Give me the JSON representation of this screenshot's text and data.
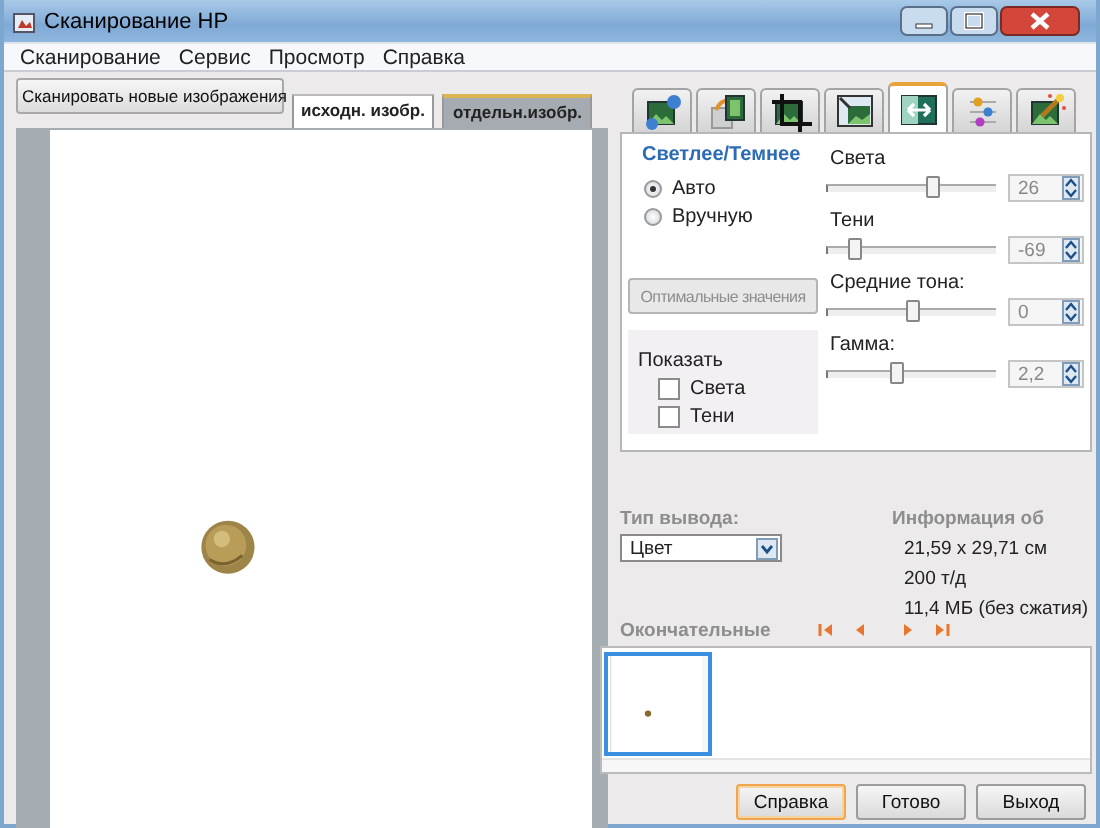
{
  "window": {
    "title": "Сканирование HP"
  },
  "menu": [
    "Сканирование",
    "Сервис",
    "Просмотр",
    "Справка"
  ],
  "scan_button": {
    "label": "Сканировать новые изображения"
  },
  "view_tabs": [
    {
      "label": "исходн. изобр.",
      "selected": true
    },
    {
      "label": "отдельн.изобр.",
      "selected": false
    }
  ],
  "preview": {
    "kind": "picture"
  },
  "tool_tabs": [
    {
      "kind": "picture-plus",
      "selected": false
    },
    {
      "kind": "picture-copy",
      "selected": false
    },
    {
      "kind": "crop",
      "selected": false
    },
    {
      "kind": "resize",
      "selected": false
    },
    {
      "kind": "brightness",
      "selected": true
    },
    {
      "kind": "color-dots",
      "selected": false
    },
    {
      "kind": "magic-wand",
      "selected": false
    }
  ],
  "adjust": {
    "title": "Светлее/Темнее",
    "modes": [
      {
        "label": "Авто",
        "selected": true
      },
      {
        "label": "Вручную",
        "selected": false
      }
    ],
    "optimal_button": {
      "label": "Оптимальные значения",
      "disabled": true
    },
    "show": {
      "title": "Показать",
      "checkboxes": [
        {
          "label": "Света",
          "checked": false
        },
        {
          "label": "Тени",
          "checked": false
        }
      ]
    },
    "sliders": [
      {
        "label": "Света",
        "level": 0.62,
        "value": "26",
        "disabled": true
      },
      {
        "label": "Тени",
        "level": 0.15,
        "value": "-69",
        "disabled": true
      },
      {
        "label": "Средние тона:",
        "level": 0.5,
        "value": "0",
        "disabled": true
      },
      {
        "label": "Гамма:",
        "level": 0.4,
        "value": "2,2",
        "disabled": true
      }
    ]
  },
  "output": {
    "label": "Тип вывода:",
    "value": "Цвет",
    "info_title": "Информация об",
    "info": [
      "21,59 x 29,71 см",
      "200 т/д",
      "11,4 МБ (без сжатия)"
    ]
  },
  "final": {
    "label": "Окончательные",
    "thumbnails": [
      {
        "kind": "picture",
        "selected": true
      }
    ]
  },
  "buttons": [
    {
      "label": "Справка",
      "focused": true
    },
    {
      "label": "Готово",
      "focused": false
    },
    {
      "label": "Выход",
      "focused": false
    }
  ]
}
